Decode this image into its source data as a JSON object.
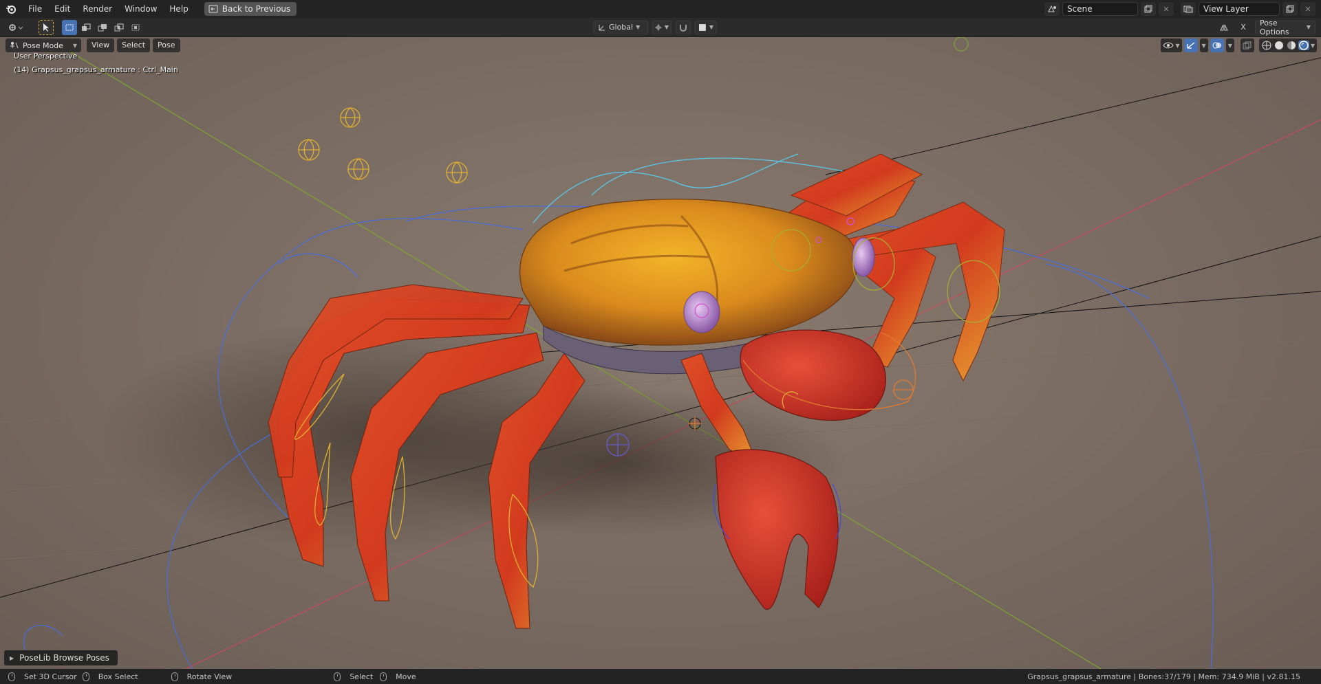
{
  "menubar": {
    "items": [
      "File",
      "Edit",
      "Render",
      "Window",
      "Help"
    ],
    "back_button": "Back to Previous",
    "scene_label": "Scene",
    "view_layer_label": "View Layer"
  },
  "toolheader": {
    "orientation": "Global",
    "pose_options": "Pose Options"
  },
  "viewport": {
    "mode": "Pose Mode",
    "menus": [
      "View",
      "Select",
      "Pose"
    ],
    "perspective": "User Perspective",
    "active_object": "(14) Grapsus_grapsus_armature : Ctrl_Main",
    "poselib_panel": "PoseLib Browse Poses"
  },
  "statusbar": {
    "hints": [
      "Set 3D Cursor",
      "Box Select",
      "Rotate View",
      "Select",
      "Move"
    ],
    "info": "Grapsus_grapsus_armature | Bones:37/179 | Mem: 734.9 MiB | v2.81.15"
  },
  "colors": {
    "accent": "#4772b3",
    "bone_yellow": "#e0b030",
    "axis_x": "#c84b5c",
    "axis_y": "#7fa532",
    "curve_blue": "#4a6cd4",
    "curve_cyan": "#5ac8e8"
  }
}
